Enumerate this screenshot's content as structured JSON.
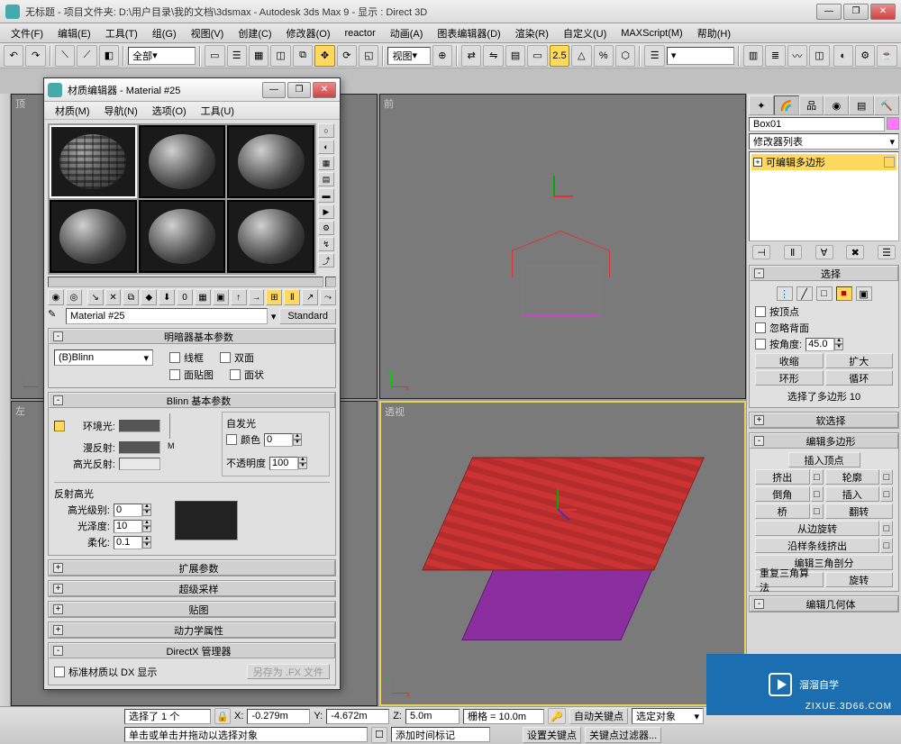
{
  "titlebar": {
    "title": "无标题   - 项目文件夹: D:\\用户目录\\我的文档\\3dsmax   - Autodesk 3ds Max 9   -  显示 : Direct 3D"
  },
  "menu": [
    "文件(F)",
    "编辑(E)",
    "工具(T)",
    "组(G)",
    "视图(V)",
    "创建(C)",
    "修改器(O)",
    "reactor",
    "动画(A)",
    "图表编辑器(D)",
    "渲染(R)",
    "自定义(U)",
    "MAXScript(M)",
    "帮助(H)"
  ],
  "toolbar1": {
    "selset": "全部",
    "view": "视图",
    "snap_angle": "2.5"
  },
  "viewports": {
    "top": "顶",
    "front": "前",
    "left": "左",
    "persp": "透视"
  },
  "matdlg": {
    "title": "材质编辑器 - Material #25",
    "menu": [
      "材质(M)",
      "导航(N)",
      "选项(O)",
      "工具(U)"
    ],
    "name": "Material #25",
    "type": "Standard",
    "rollouts": {
      "basic_shader": "明暗器基本参数",
      "shader": "(B)Blinn",
      "wire": "线框",
      "twosided": "双面",
      "facemap": "面贴图",
      "faceted": "面状",
      "blinn": "Blinn 基本参数",
      "selfillum": "自发光",
      "color": "颜色",
      "si_val": "0",
      "ambient": "环境光:",
      "diffuse": "漫反射:",
      "specular": "高光反射:",
      "opacity": "不透明度",
      "opacity_val": "100",
      "spec_hi": "反射高光",
      "spec_level": "高光级别:",
      "spec_level_val": "0",
      "gloss": "光泽度:",
      "gloss_val": "10",
      "soften": "柔化:",
      "soften_val": "0.1",
      "ext": "扩展参数",
      "super": "超级采样",
      "maps": "贴图",
      "dyn": "动力学属性",
      "dx": "DirectX 管理器",
      "dx_std": "标准材质以 DX 显示",
      "saveas": "另存为 .FX 文件"
    }
  },
  "rpanel": {
    "obj_name": "Box01",
    "modlist": "修改器列表",
    "stack_item": "可编辑多边形",
    "sel_hdr": "选择",
    "by_vertex": "按顶点",
    "ignore_bf": "忽略背面",
    "by_angle": "按角度:",
    "angle": "45.0",
    "shrink": "收缩",
    "grow": "扩大",
    "ring": "环形",
    "loop": "循环",
    "sel_status": "选择了多边形 10",
    "soft": "软选择",
    "edit_poly": "编辑多边形",
    "ins_vert": "插入顶点",
    "extrude": "挤出",
    "outline": "轮廓",
    "bevel": "倒角",
    "inset": "插入",
    "bridge": "桥",
    "flip": "翻转",
    "hinge": "从边旋转",
    "extrude_spline": "沿样条线挤出",
    "edit_tri": "编辑三角剖分",
    "retri": "重复三角算法",
    "turn": "旋转",
    "edit_geom": "编辑几何体"
  },
  "status": {
    "sel": "选择了 1 个",
    "x": "-0.279m",
    "y": "-4.672m",
    "z": "5.0m",
    "grid": "栅格 = 10.0m",
    "autokey": "自动关键点",
    "selobj": "选定对象",
    "prompt": "单击或单击并拖动以选择对象",
    "addtm": "添加时间标记",
    "setkey": "设置关键点",
    "filters": "关键点过滤器..."
  },
  "watermark": {
    "brand": "溜溜自学",
    "url": "ZIXUE.3D66.COM"
  }
}
